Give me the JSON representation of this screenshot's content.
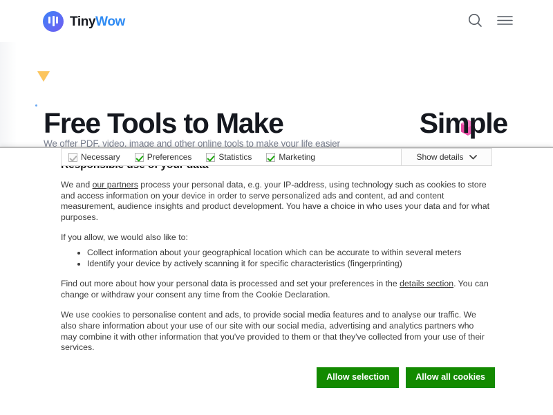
{
  "site": {
    "brand": {
      "name_primary": "Tiny",
      "name_accent": "Wow",
      "logo_icon": "tinywow-logo-icon"
    },
    "header_icons": {
      "search": "search-icon",
      "menu": "hamburger-menu-icon"
    },
    "hero": {
      "title_left": "Free Tools to Make",
      "title_right": "Simple",
      "subtitle": "We offer PDF, video, image and other online tools to make your life easier",
      "decorations": [
        "triangle-orange-icon",
        "cube-pink-icon",
        "pyramid-blue-icon"
      ]
    },
    "colors": {
      "brand_accent": "#2f8bf3",
      "text_dark": "#15181f",
      "muted": "#7b8190"
    }
  },
  "cookie_dialog": {
    "title": "Responsible use of your data",
    "paragraph_1_pre": "We and ",
    "paragraph_1_link": "our partners",
    "paragraph_1_post": " process your personal data, e.g. your IP-address, using technology such as cookies to store and access information on your device in order to serve personalized ads and content, ad and content measurement, audience insights and product development. You have a choice in who uses your data and for what purposes.",
    "paragraph_2": "If you allow, we would also like to:",
    "bullets": [
      "Collect information about your geographical location which can be accurate to within several meters",
      "Identify your device by actively scanning it for specific characteristics (fingerprinting)"
    ],
    "paragraph_3_pre": "Find out more about how your personal data is processed and set your preferences in the ",
    "paragraph_3_link": "details section",
    "paragraph_3_post": ". You can change or withdraw your consent any time from the Cookie Declaration.",
    "paragraph_4": "We use cookies to personalise content and ads, to provide social media features and to analyse our traffic. We also share information about your use of our site with our social media, advertising and analytics partners who may combine it with other information that you've provided to them or that they've collected from your use of their services.",
    "buttons": {
      "allow_selection": "Allow selection",
      "allow_all": "Allow all cookies",
      "color": "#138a00"
    },
    "categories": [
      {
        "label": "Necessary",
        "checked": true,
        "locked": true
      },
      {
        "label": "Preferences",
        "checked": true,
        "locked": false
      },
      {
        "label": "Statistics",
        "checked": true,
        "locked": false
      },
      {
        "label": "Marketing",
        "checked": true,
        "locked": false
      }
    ],
    "show_details": {
      "label": "Show details",
      "icon": "chevron-down-icon"
    }
  }
}
